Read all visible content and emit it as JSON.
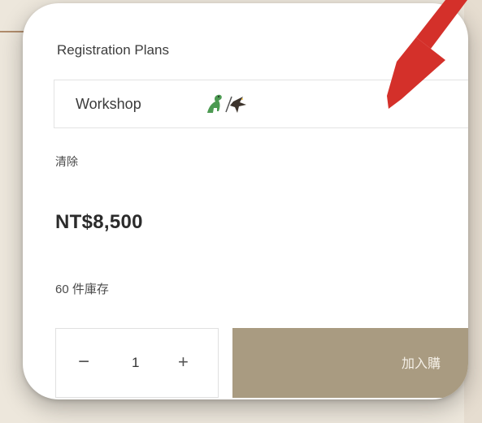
{
  "form": {
    "plans_label": "Registration Plans",
    "selected_plan": "Workshop",
    "clear_label": "清除",
    "price": "NT$8,500",
    "stock": "60 件庫存",
    "quantity": "1",
    "minus": "−",
    "plus": "+",
    "add_to_cart": "加入購"
  },
  "colors": {
    "button": "#a99b81",
    "arrow": "#d4302a",
    "background": "#ede7dc"
  },
  "icons": {
    "plan_emoji": "dinosaur-and-bird-emoji",
    "annotation": "red-arrow"
  }
}
